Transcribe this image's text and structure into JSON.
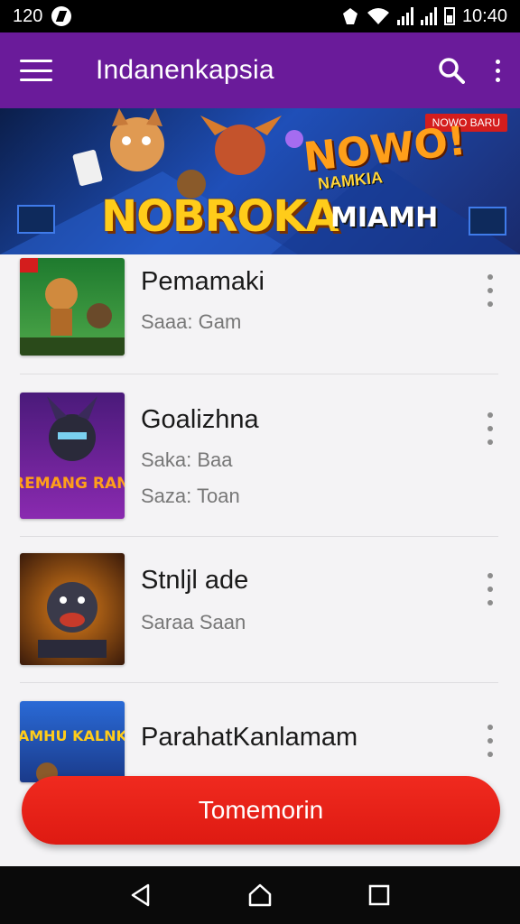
{
  "status_bar": {
    "time_left": "120",
    "time_right": "10:40"
  },
  "app_bar": {
    "title": "Indanenkapsia"
  },
  "banner": {
    "tag": "NOWO BARU",
    "main_text": "NOBROKA",
    "side_text": "MIAMH",
    "burst_text": "NOWO!",
    "burst_sub": "NAMKIA"
  },
  "items": [
    {
      "title": "Pemamaki",
      "sub1": "Saaa: Gam",
      "sub2": ""
    },
    {
      "title": "Goalizhna",
      "sub1": "Saka: Baa",
      "sub2": "Saza: Toan",
      "thumb_text": "FREMANG RANN"
    },
    {
      "title": "Stnljl ade",
      "sub1": "Saraa Saan",
      "sub2": ""
    },
    {
      "title": "ParahatKanlamam",
      "sub1": "",
      "sub2": "",
      "thumb_text": "NAMHU KALNKU"
    }
  ],
  "cta": {
    "label": "Tomemorin"
  },
  "colors": {
    "app_bar": "#6a1b9a",
    "cta": "#e8201a",
    "status_bar": "#000000"
  }
}
